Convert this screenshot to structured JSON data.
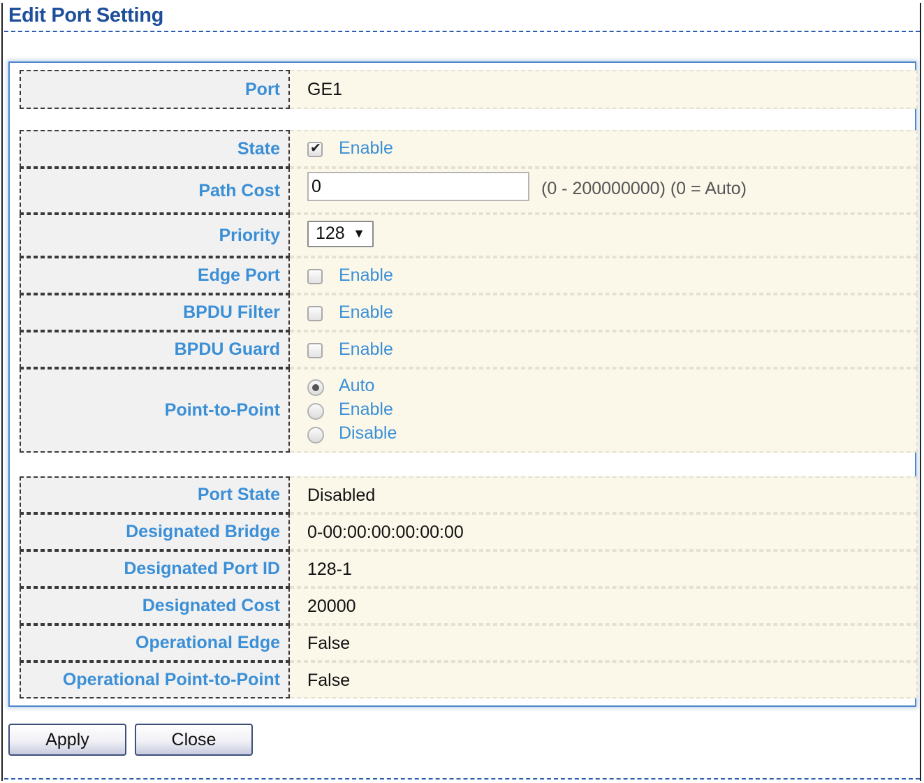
{
  "page_title": "Edit Port Setting",
  "port": {
    "label": "Port",
    "value": "GE1"
  },
  "settings": {
    "state": {
      "label": "State",
      "option": "Enable",
      "checked": true
    },
    "path_cost": {
      "label": "Path Cost",
      "value": "0",
      "hint": "(0 - 200000000) (0 = Auto)"
    },
    "priority": {
      "label": "Priority",
      "selected": "128"
    },
    "edge_port": {
      "label": "Edge Port",
      "option": "Enable",
      "checked": false
    },
    "bpdu_filter": {
      "label": "BPDU Filter",
      "option": "Enable",
      "checked": false
    },
    "bpdu_guard": {
      "label": "BPDU Guard",
      "option": "Enable",
      "checked": false
    },
    "point_to_point": {
      "label": "Point-to-Point",
      "options": [
        "Auto",
        "Enable",
        "Disable"
      ],
      "selected": "Auto"
    }
  },
  "status": {
    "port_state": {
      "label": "Port State",
      "value": "Disabled"
    },
    "designated_bridge": {
      "label": "Designated Bridge",
      "value": "0-00:00:00:00:00:00"
    },
    "designated_port_id": {
      "label": "Designated Port ID",
      "value": "128-1"
    },
    "designated_cost": {
      "label": "Designated Cost",
      "value": "20000"
    },
    "operational_edge": {
      "label": "Operational Edge",
      "value": "False"
    },
    "operational_p2p": {
      "label": "Operational Point-to-Point",
      "value": "False"
    }
  },
  "buttons": {
    "apply": "Apply",
    "close": "Close"
  },
  "colors": {
    "label_text": "#3b8fd6",
    "title": "#1f4e9a",
    "value_bg": "#fbf8ea",
    "label_bg": "#f1f1f1"
  }
}
